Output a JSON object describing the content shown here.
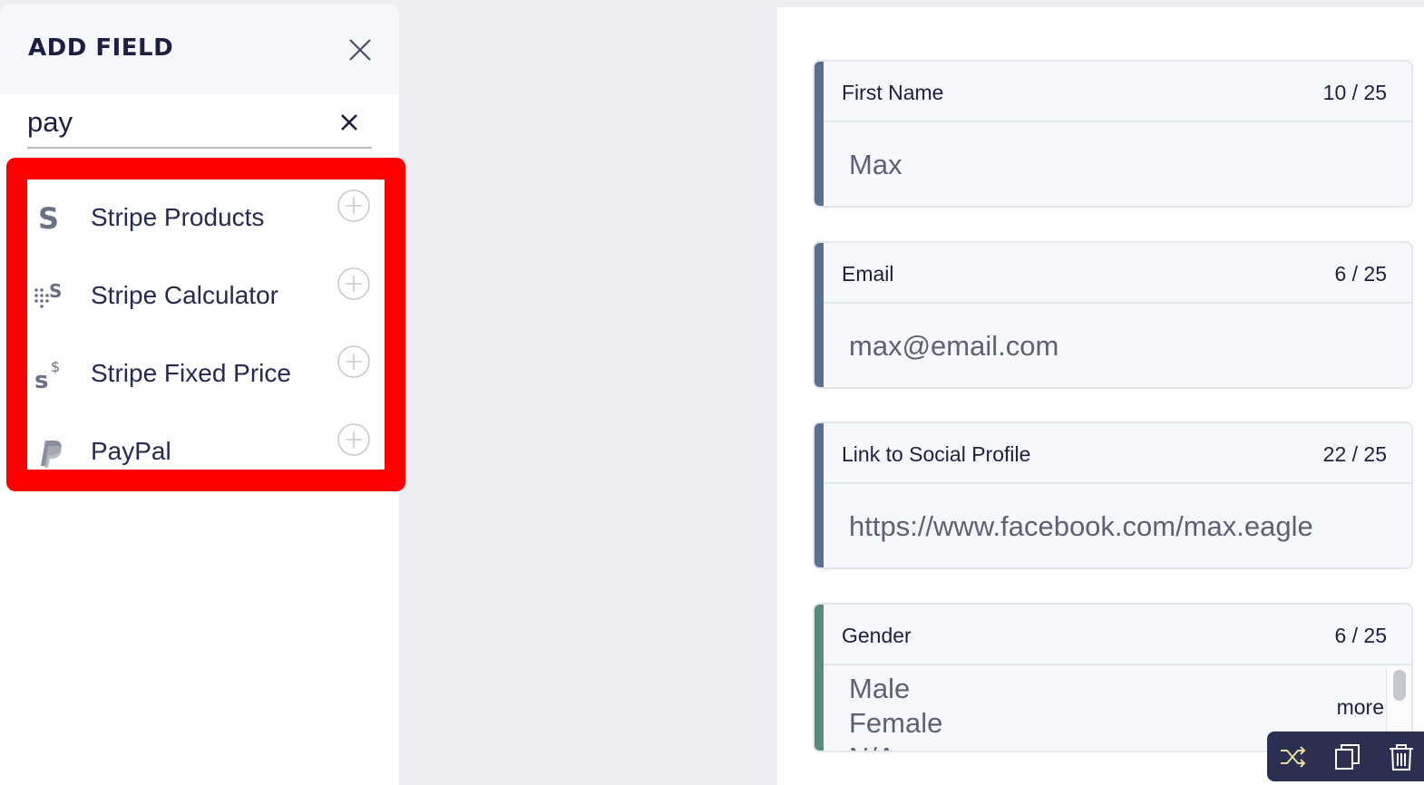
{
  "panel": {
    "title": "ADD FIELD",
    "search": {
      "value": "pay",
      "placeholder": ""
    },
    "results": [
      {
        "label": "Stripe Products",
        "icon": "stripe-icon"
      },
      {
        "label": "Stripe Calculator",
        "icon": "stripe-calculator-icon"
      },
      {
        "label": "Stripe Fixed Price",
        "icon": "stripe-dollar-icon"
      },
      {
        "label": "PayPal",
        "icon": "paypal-icon"
      }
    ]
  },
  "form": {
    "fields": [
      {
        "label": "First Name",
        "count": "10 / 25",
        "value": "Max",
        "accent": "#5b6f91"
      },
      {
        "label": "Email",
        "count": "6 / 25",
        "value": "max@email.com",
        "accent": "#5b6f91"
      },
      {
        "label": "Link to Social Profile",
        "count": "22 / 25",
        "value": "https://www.facebook.com/max.eagle",
        "accent": "#5b6f91"
      }
    ],
    "gender": {
      "label": "Gender",
      "count": "6 / 25",
      "options": [
        "Male",
        "Female",
        "N/A"
      ],
      "more": "more",
      "accent": "#5a8a79"
    }
  },
  "colors": {
    "highlight": "#ff0000",
    "toolbar": "#2b2f52"
  }
}
